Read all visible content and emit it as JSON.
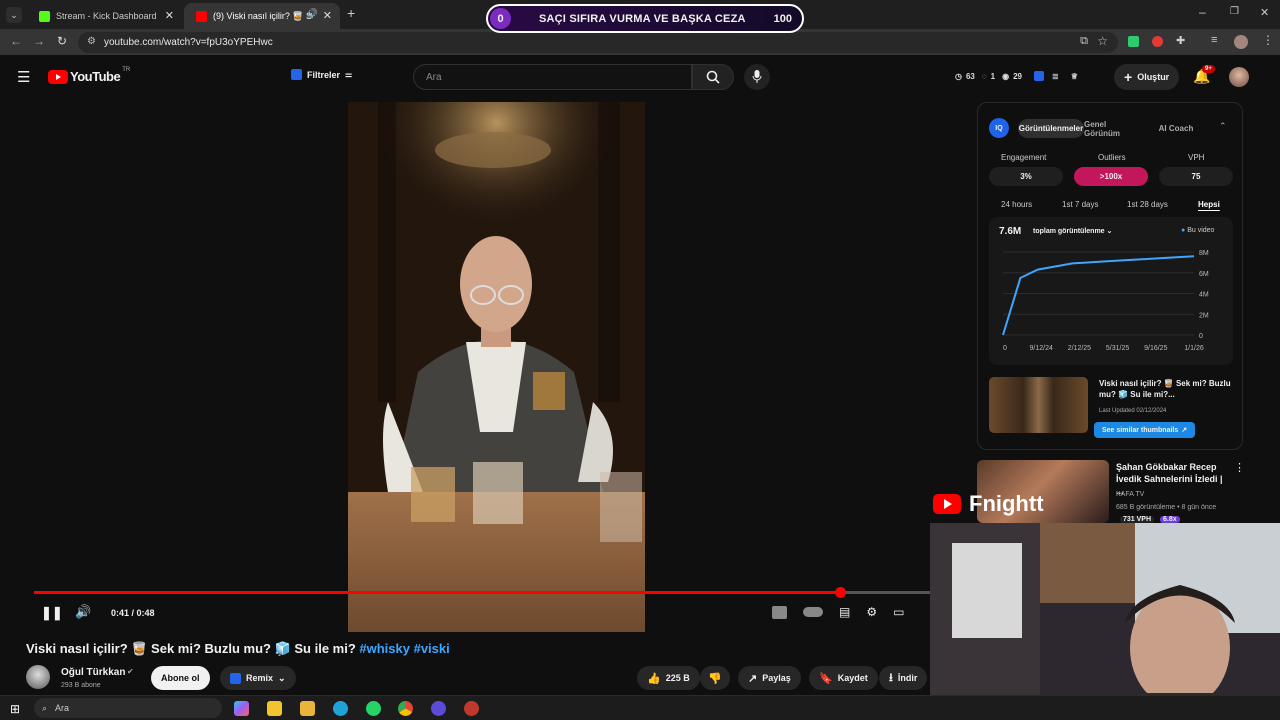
{
  "browser": {
    "tabs": [
      {
        "label": "Stream - Kick Dashboard",
        "favicon_color": "#53fc18"
      },
      {
        "label": "(9) Viski nasıl içilir? 🥃 Sek",
        "favicon_color": "#ff0000"
      }
    ],
    "new_tab_symbol": "+",
    "url": "youtube.com/watch?v=fpU3oYPEHwc"
  },
  "overlay": {
    "left_count": "0",
    "text": "SAÇI SIFIRA VURMA VE BAŞKA CEZA",
    "right_count": "100"
  },
  "youtube": {
    "logo_text": "YouTube",
    "region": "TR",
    "filters_label": "Filtreler",
    "search_placeholder": "Ara",
    "stats": {
      "a": "63",
      "b": "1",
      "c": "29"
    },
    "create_label": "Oluştur",
    "notifications": "9+"
  },
  "player": {
    "time": "0:41 / 0:48",
    "progress_fraction": 0.898
  },
  "video": {
    "title_plain": "Viski nasıl içilir? 🥃 Sek mi? Buzlu mu? 🧊 Su ile mi? ",
    "hashtags": "#whisky #viski",
    "channel": "Oğul Türkkan",
    "subscribers": "293 B abone",
    "subscribe_label": "Abone ol",
    "remix_label": "Remix",
    "likes": "225 B",
    "share_label": "Paylaş",
    "save_label": "Kaydet",
    "download_label": "İndir"
  },
  "vidiq": {
    "tabs": [
      "Görüntülenmeler",
      "Genel Görünüm",
      "AI Coach"
    ],
    "metrics": [
      {
        "label": "Engagement",
        "value": "3%"
      },
      {
        "label": "Outliers",
        "value": ">100x"
      },
      {
        "label": "VPH",
        "value": "75"
      }
    ],
    "ranges": [
      "24 hours",
      "1st 7 days",
      "1st 28 days",
      "Hepsi"
    ],
    "total_views": "7.6M",
    "total_label": "toplam görüntülenme",
    "legend_label": "Bu video",
    "related_title": "Viski nasıl içilir? 🥃 Sek mi? Buzlu mu? 🧊 Su ile mi?...",
    "last_updated": "Last Updated 02/12/2024",
    "similar_label": "See similar thumbnails",
    "accent": "#1e88e5",
    "outlier_color": "#c2185b"
  },
  "chart_data": {
    "type": "line",
    "x_ticks": [
      "0",
      "9/12/24",
      "2/12/25",
      "5/31/25",
      "9/16/25",
      "1/1/26"
    ],
    "y_ticks": [
      "0",
      "2M",
      "4M",
      "6M",
      "8M"
    ],
    "ylim": [
      0,
      8000000
    ],
    "series": [
      {
        "values": [
          0,
          5500000,
          6300000,
          6600000,
          6900000,
          7000000,
          7100000,
          7200000,
          7300000,
          7400000,
          7500000,
          7600000
        ]
      }
    ]
  },
  "recommendation": {
    "title": "Şahan Gökbakar Recep İvedik Sahnelerini İzledi | ...",
    "channel": "KAFA TV",
    "meta": "685 B görüntüleme • 8 gün önce",
    "vph": "731 VPH",
    "ratio": "6.8x"
  },
  "streamer": {
    "name": "Fnightt"
  },
  "taskbar": {
    "search_placeholder": "Ara"
  }
}
